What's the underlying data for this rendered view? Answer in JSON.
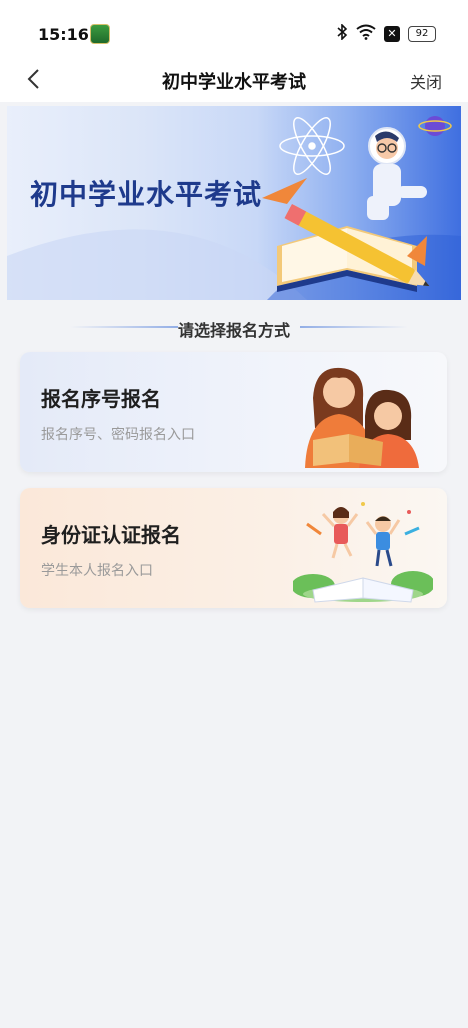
{
  "status_bar": {
    "time": "15:16",
    "icons": [
      "bluetooth-icon",
      "wifi-icon",
      "x-icon",
      "battery-icon"
    ],
    "battery": "92"
  },
  "nav": {
    "title": "初中学业水平考试",
    "close_label": "关闭"
  },
  "banner": {
    "title": "初中学业水平考试"
  },
  "section": {
    "title": "请选择报名方式"
  },
  "options": [
    {
      "title": "报名序号报名",
      "subtitle": "报名序号、密码报名入口"
    },
    {
      "title": "身份证认证报名",
      "subtitle": "学生本人报名入口"
    }
  ]
}
